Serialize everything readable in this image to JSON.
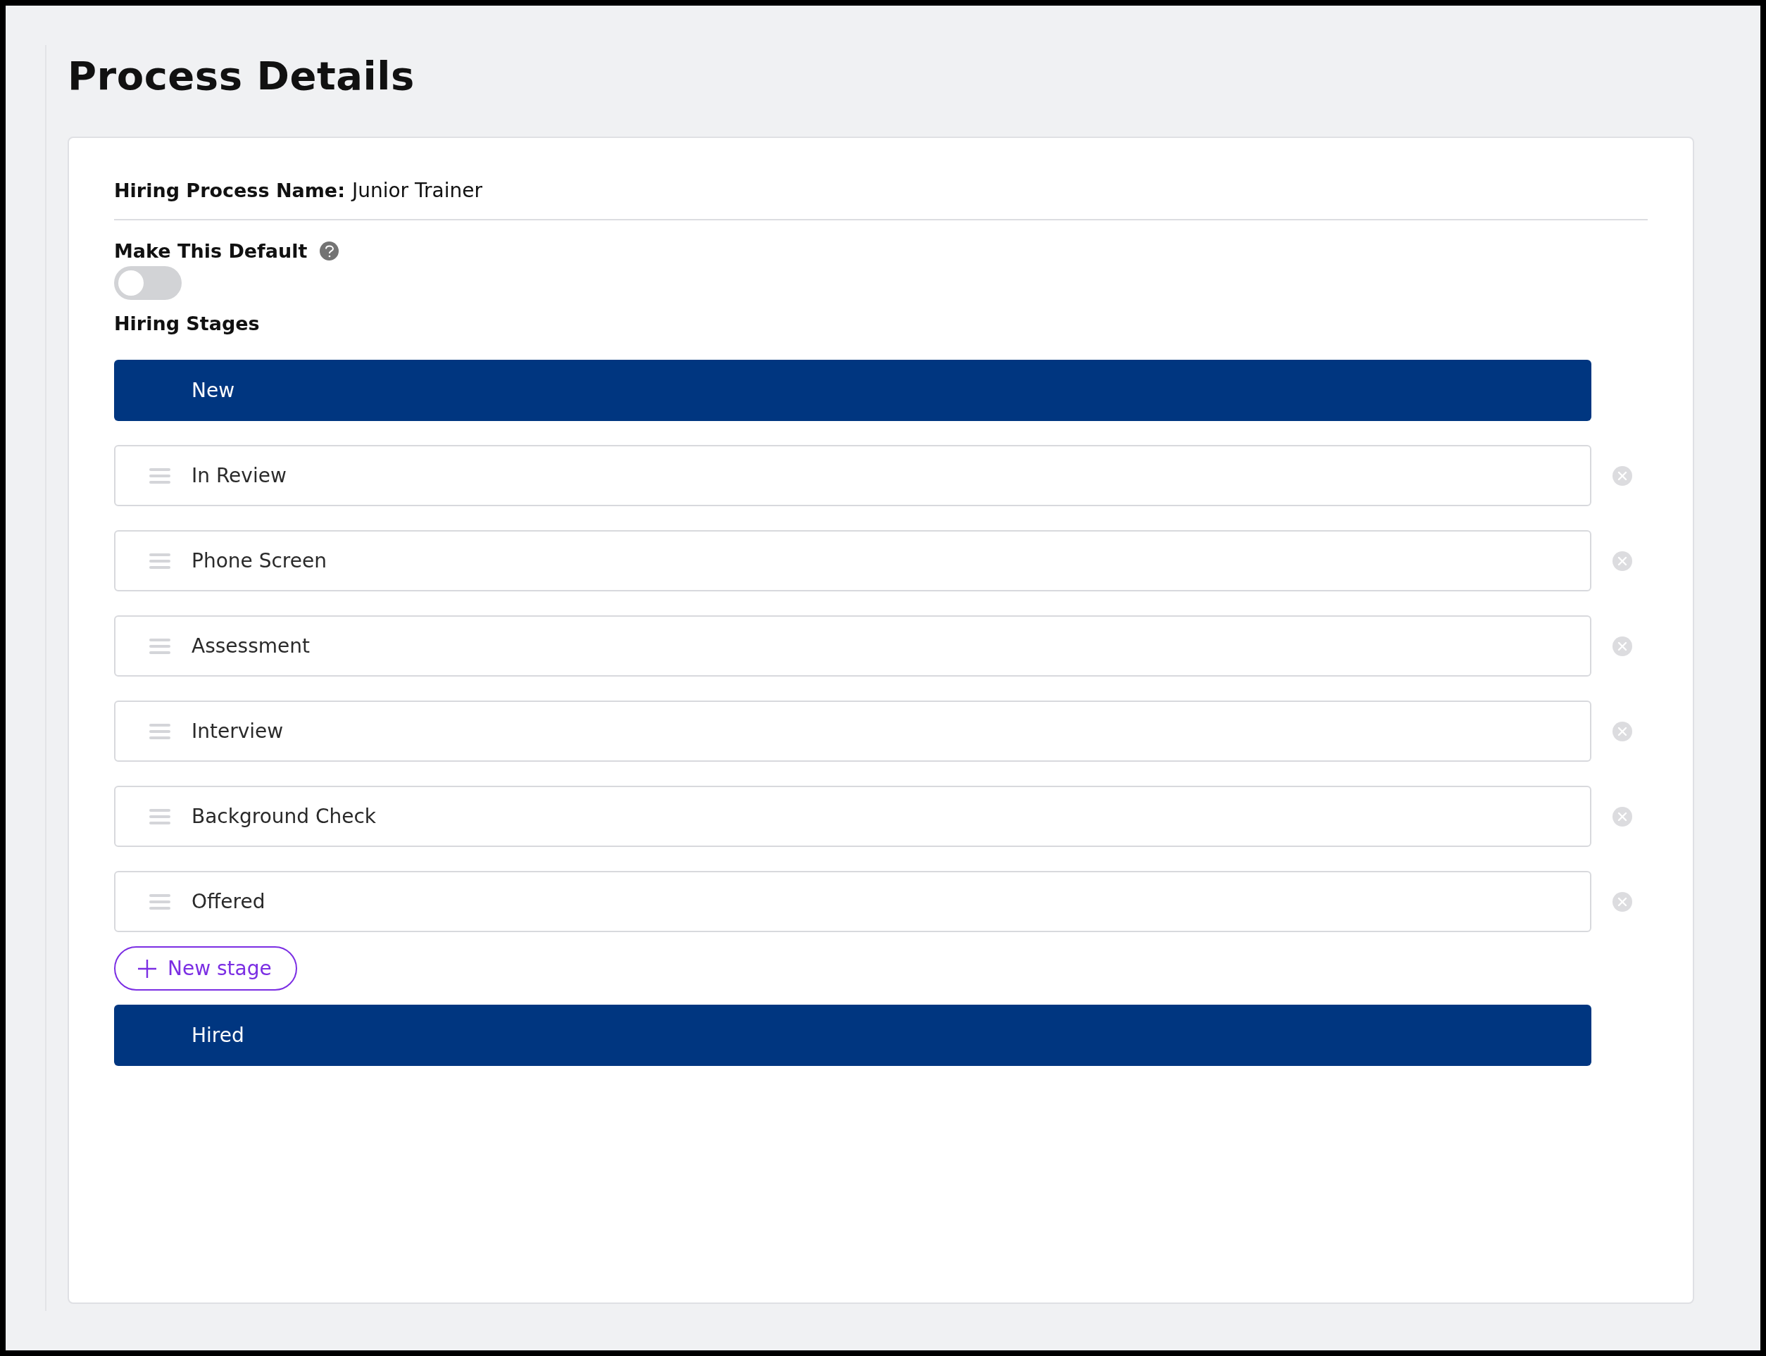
{
  "page": {
    "title": "Process Details"
  },
  "process_name": {
    "label": "Hiring Process Name:",
    "value": "Junior Trainer"
  },
  "default_setting": {
    "label": "Make This Default",
    "on": false
  },
  "stages_heading": "Hiring Stages",
  "stages": [
    {
      "kind": "fixed",
      "label": "New"
    },
    {
      "kind": "editable",
      "label": "In Review"
    },
    {
      "kind": "editable",
      "label": "Phone Screen"
    },
    {
      "kind": "editable",
      "label": "Assessment"
    },
    {
      "kind": "editable",
      "label": "Interview"
    },
    {
      "kind": "editable",
      "label": "Background Check"
    },
    {
      "kind": "editable",
      "label": "Offered"
    },
    {
      "kind": "add",
      "label": "New stage"
    },
    {
      "kind": "fixed",
      "label": "Hired"
    }
  ]
}
